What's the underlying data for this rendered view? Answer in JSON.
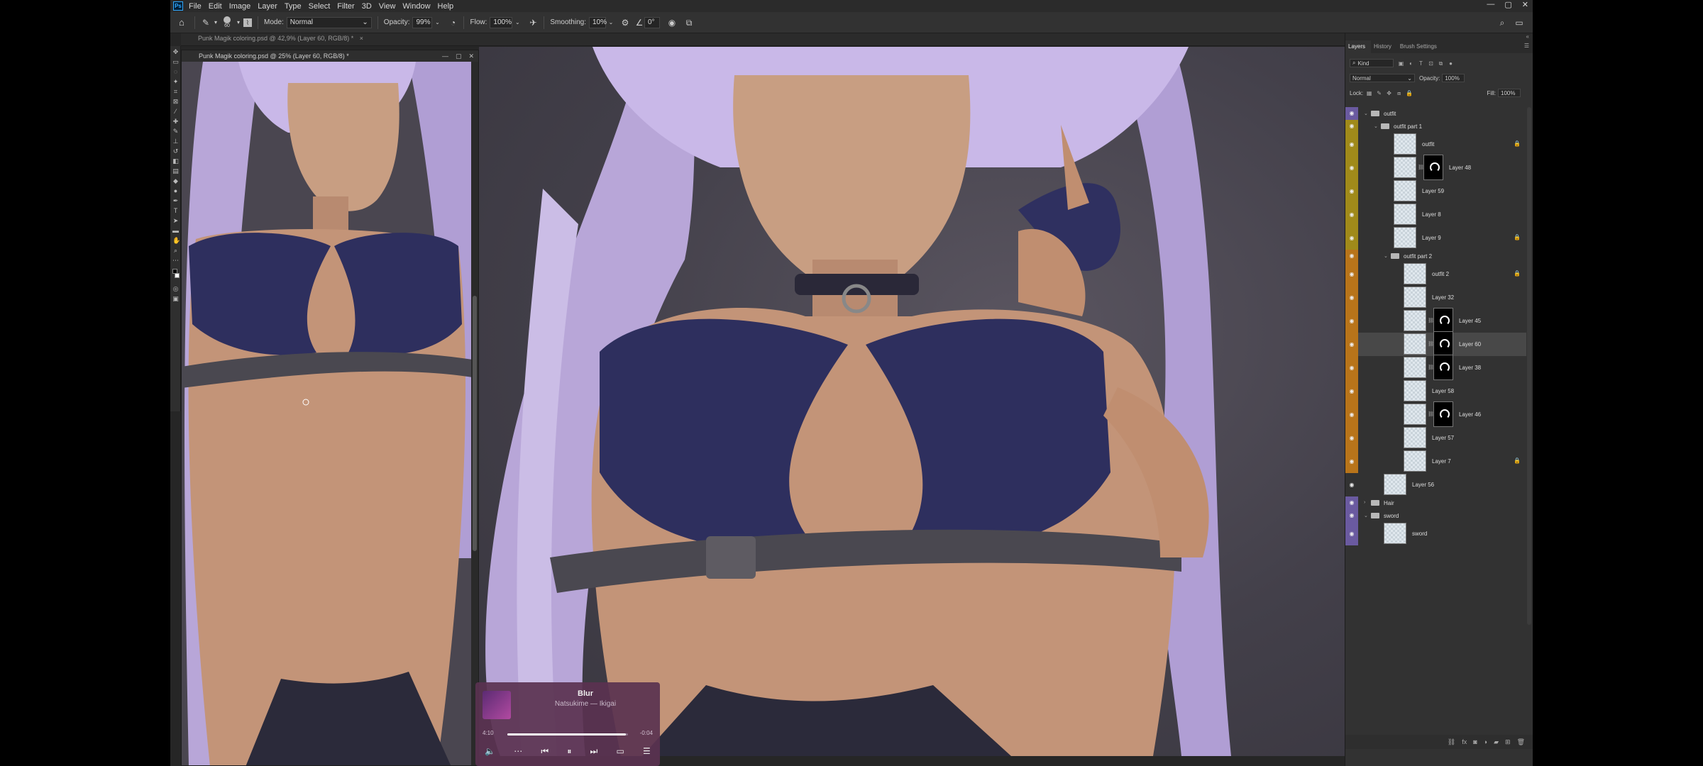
{
  "colors": {
    "accent": "#31a8ff",
    "orange": "#b8741a",
    "olive": "#a08a1a",
    "purple": "#6a5aa0"
  },
  "menu": {
    "items": [
      "File",
      "Edit",
      "Image",
      "Layer",
      "Type",
      "Select",
      "Filter",
      "3D",
      "View",
      "Window",
      "Help"
    ]
  },
  "options": {
    "brush_size": "60",
    "mode_label": "Mode:",
    "mode_value": "Normal",
    "opacity_label": "Opacity:",
    "opacity_value": "99%",
    "flow_label": "Flow:",
    "flow_value": "100%",
    "smoothing_label": "Smoothing:",
    "smoothing_value": "10%",
    "angle_value": "0°"
  },
  "tabs": {
    "main": "Punk Magik coloring.psd @ 42,9% (Layer 60, RGB/8) *"
  },
  "docwin": {
    "title": "Punk Magik coloring.psd @ 25% (Layer 60, RGB/8) *"
  },
  "music": {
    "title": "Blur",
    "artist": "Natsukime — Ikigai",
    "elapsed": "4:10",
    "remaining": "-0:04",
    "progress": 0.98
  },
  "panel": {
    "tabs": [
      "Layers",
      "History",
      "Brush Settings"
    ],
    "kind": "Kind",
    "blend": "Normal",
    "opacity_label": "Opacity:",
    "opacity_value": "100%",
    "lock_label": "Lock:",
    "fill_label": "Fill:",
    "fill_value": "100%"
  },
  "layers": [
    {
      "name": "outfit",
      "kind": "group",
      "indent": 0,
      "color": "purple"
    },
    {
      "name": "outfit part 1",
      "kind": "group",
      "indent": 1,
      "color": "olive"
    },
    {
      "name": "outfit",
      "kind": "layer",
      "indent": 2,
      "color": "olive",
      "locked": true
    },
    {
      "name": "Layer 48",
      "kind": "layer-mask",
      "indent": 2,
      "color": "olive"
    },
    {
      "name": "Layer 59",
      "kind": "layer",
      "indent": 2,
      "color": "olive"
    },
    {
      "name": "Layer 8",
      "kind": "layer",
      "indent": 2,
      "color": "olive"
    },
    {
      "name": "Layer 9",
      "kind": "layer",
      "indent": 2,
      "color": "olive",
      "locked": true
    },
    {
      "name": "outfit part 2",
      "kind": "group",
      "indent": 2,
      "color": "orange"
    },
    {
      "name": "outfit 2",
      "kind": "layer",
      "indent": 3,
      "color": "orange",
      "locked": true
    },
    {
      "name": "Layer 32",
      "kind": "layer",
      "indent": 3,
      "color": "orange"
    },
    {
      "name": "Layer 45",
      "kind": "layer-mask",
      "indent": 3,
      "color": "orange"
    },
    {
      "name": "Layer 60",
      "kind": "layer-mask",
      "indent": 3,
      "color": "orange",
      "selected": true
    },
    {
      "name": "Layer 38",
      "kind": "layer-mask",
      "indent": 3,
      "color": "orange"
    },
    {
      "name": "Layer 58",
      "kind": "layer",
      "indent": 3,
      "color": "orange"
    },
    {
      "name": "Layer 46",
      "kind": "layer-mask",
      "indent": 3,
      "color": "orange"
    },
    {
      "name": "Layer 57",
      "kind": "layer",
      "indent": 3,
      "color": "orange"
    },
    {
      "name": "Layer 7",
      "kind": "layer",
      "indent": 3,
      "color": "orange",
      "locked": true
    },
    {
      "name": "Layer 56",
      "kind": "layer",
      "indent": 1,
      "color": "none"
    },
    {
      "name": "Hair",
      "kind": "group",
      "indent": 0,
      "color": "purple"
    },
    {
      "name": "sword",
      "kind": "group",
      "indent": 0,
      "color": "purple"
    },
    {
      "name": "sword",
      "kind": "layer",
      "indent": 1,
      "color": "purple"
    }
  ]
}
